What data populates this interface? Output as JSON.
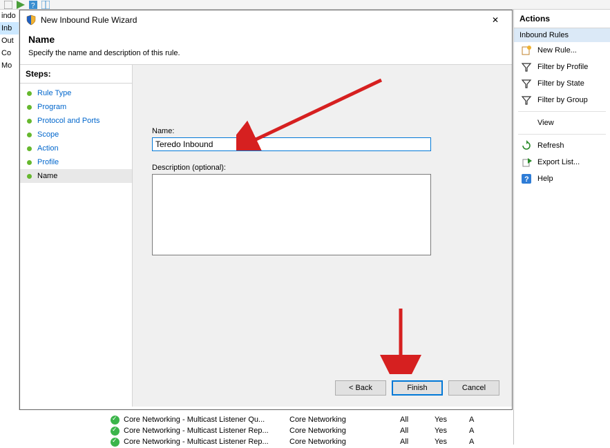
{
  "left_tree": {
    "items": [
      "indo",
      "Inb",
      "Out",
      "Co",
      "Mo"
    ],
    "selected_index": 1
  },
  "dialog": {
    "title": "New Inbound Rule Wizard",
    "heading": "Name",
    "subheading": "Specify the name and description of this rule.",
    "close_glyph": "✕",
    "steps_header": "Steps:",
    "steps": [
      {
        "label": "Rule Type"
      },
      {
        "label": "Program"
      },
      {
        "label": "Protocol and Ports"
      },
      {
        "label": "Scope"
      },
      {
        "label": "Action"
      },
      {
        "label": "Profile"
      },
      {
        "label": "Name"
      }
    ],
    "current_step_index": 6,
    "name_label": "Name:",
    "name_value": "Teredo Inbound",
    "desc_label": "Description (optional):",
    "desc_value": "",
    "buttons": {
      "back": "< Back",
      "finish": "Finish",
      "cancel": "Cancel"
    }
  },
  "rules_rows": [
    {
      "name": "Core Networking - Multicast Listener Qu...",
      "group": "Core Networking",
      "profile": "All",
      "enabled": "Yes",
      "action": "A"
    },
    {
      "name": "Core Networking - Multicast Listener Rep...",
      "group": "Core Networking",
      "profile": "All",
      "enabled": "Yes",
      "action": "A"
    },
    {
      "name": "Core Networking - Multicast Listener Rep...",
      "group": "Core Networking",
      "profile": "All",
      "enabled": "Yes",
      "action": "A"
    }
  ],
  "actions": {
    "header": "Actions",
    "section_title": "Inbound Rules",
    "items_top": [
      {
        "icon": "new",
        "label": "New Rule..."
      },
      {
        "icon": "filter",
        "label": "Filter by Profile"
      },
      {
        "icon": "filter",
        "label": "Filter by State"
      },
      {
        "icon": "filter",
        "label": "Filter by Group"
      }
    ],
    "view_label": "View",
    "items_bottom": [
      {
        "icon": "refresh",
        "label": "Refresh"
      },
      {
        "icon": "export",
        "label": "Export List..."
      },
      {
        "icon": "help",
        "label": "Help"
      }
    ]
  }
}
